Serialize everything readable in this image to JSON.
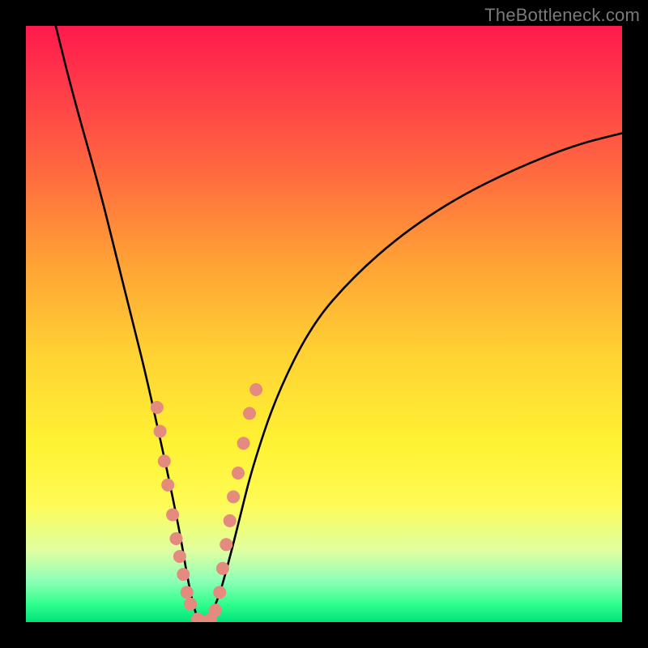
{
  "watermark": "TheBottleneck.com",
  "chart_data": {
    "type": "line",
    "title": "",
    "xlabel": "",
    "ylabel": "",
    "xlim": [
      0,
      100
    ],
    "ylim": [
      0,
      100
    ],
    "series": [
      {
        "name": "bottleneck-curve",
        "x": [
          5,
          8,
          12,
          15,
          18,
          20,
          22,
          24,
          26,
          27,
          28,
          29,
          30,
          32,
          34,
          36,
          38,
          42,
          48,
          55,
          63,
          72,
          82,
          92,
          100
        ],
        "y": [
          100,
          88,
          74,
          62,
          50,
          42,
          33,
          24,
          14,
          8,
          3,
          0,
          0,
          3,
          10,
          18,
          26,
          38,
          50,
          58,
          65,
          71,
          76,
          80,
          82
        ]
      }
    ],
    "markers": {
      "name": "highlighted-points",
      "color": "#e58a7e",
      "points": [
        {
          "x": 22.0,
          "y": 36
        },
        {
          "x": 22.5,
          "y": 32
        },
        {
          "x": 23.2,
          "y": 27
        },
        {
          "x": 23.8,
          "y": 23
        },
        {
          "x": 24.6,
          "y": 18
        },
        {
          "x": 25.2,
          "y": 14
        },
        {
          "x": 25.8,
          "y": 11
        },
        {
          "x": 26.4,
          "y": 8
        },
        {
          "x": 27.0,
          "y": 5
        },
        {
          "x": 27.6,
          "y": 3
        },
        {
          "x": 28.8,
          "y": 0.5
        },
        {
          "x": 29.5,
          "y": 0
        },
        {
          "x": 30.2,
          "y": 0
        },
        {
          "x": 31.0,
          "y": 0.5
        },
        {
          "x": 31.8,
          "y": 2
        },
        {
          "x": 32.5,
          "y": 5
        },
        {
          "x": 33.0,
          "y": 9
        },
        {
          "x": 33.6,
          "y": 13
        },
        {
          "x": 34.2,
          "y": 17
        },
        {
          "x": 34.8,
          "y": 21
        },
        {
          "x": 35.6,
          "y": 25
        },
        {
          "x": 36.5,
          "y": 30
        },
        {
          "x": 37.5,
          "y": 35
        },
        {
          "x": 38.6,
          "y": 39
        }
      ]
    }
  }
}
